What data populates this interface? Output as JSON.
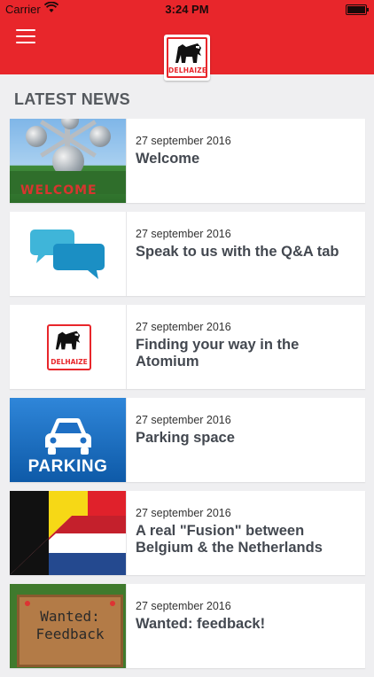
{
  "status_bar": {
    "carrier": "Carrier",
    "time": "3:24 PM"
  },
  "header": {
    "menu_icon": "hamburger-menu-icon",
    "logo_word": "DELHAIZE",
    "brand_color": "#e8262b"
  },
  "section": {
    "title": "LATEST NEWS"
  },
  "news": [
    {
      "date": "27 september 2016",
      "title": "Welcome",
      "thumb_text": "WELCOME"
    },
    {
      "date": "27 september 2016",
      "title": "Speak to us with the Q&A tab"
    },
    {
      "date": "27 september 2016",
      "title": "Finding your way in the Atomium",
      "thumb_text": "DELHAIZE"
    },
    {
      "date": "27 september 2016",
      "title": "Parking space",
      "thumb_text": "PARKING"
    },
    {
      "date": "27 september 2016",
      "title": "A real \"Fusion\" between Belgium & the Netherlands"
    },
    {
      "date": "27 september 2016",
      "title": "Wanted: feedback!",
      "thumb_text_line1": "Wanted:",
      "thumb_text_line2": "Feedback"
    }
  ]
}
